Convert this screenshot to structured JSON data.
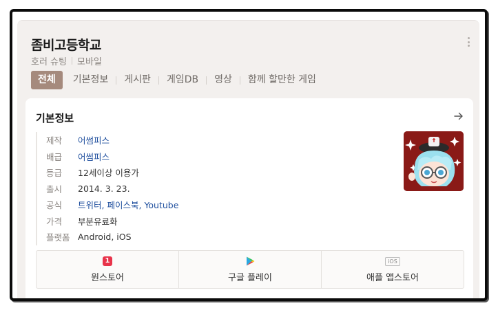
{
  "header": {
    "title": "좀비고등학교",
    "genre": "호러 슈팅",
    "platform_tag": "모바일"
  },
  "tabs": [
    {
      "label": "전체",
      "active": true
    },
    {
      "label": "기본정보",
      "active": false
    },
    {
      "label": "게시판",
      "active": false
    },
    {
      "label": "게임DB",
      "active": false
    },
    {
      "label": "영상",
      "active": false
    },
    {
      "label": "함께 할만한 게임",
      "active": false
    }
  ],
  "info_card": {
    "title": "기본정보",
    "rows": [
      {
        "key": "제작",
        "value": "어썸피스"
      },
      {
        "key": "배급",
        "value": "어썸피스"
      },
      {
        "key": "등급",
        "value": "12세이상 이용가"
      },
      {
        "key": "출시",
        "value": "2014. 3. 23."
      },
      {
        "key": "공식",
        "links": [
          "트위터",
          "페이스북",
          "Youtube"
        ]
      },
      {
        "key": "가격",
        "value": "부분유료화"
      },
      {
        "key": "플랫폼",
        "value": "Android, iOS"
      }
    ]
  },
  "stores": [
    {
      "label": "원스토어",
      "icon": "onestore-icon",
      "badge": "1"
    },
    {
      "label": "구글 플레이",
      "icon": "google-play-icon"
    },
    {
      "label": "애플 앱스토어",
      "icon": "apple-appstore-icon",
      "badge": "iOS"
    }
  ],
  "colors": {
    "active_tab": "#a58a7d",
    "link": "#1f4f9e",
    "panel_bg": "#f3f0ee"
  }
}
